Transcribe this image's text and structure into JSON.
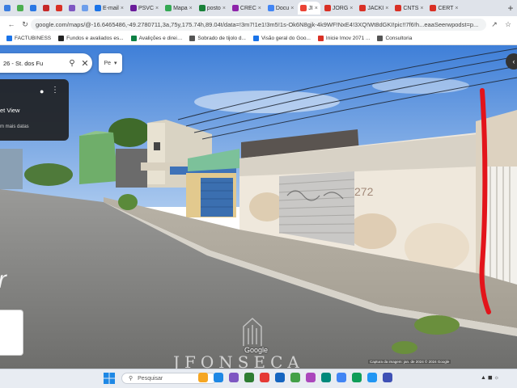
{
  "browser": {
    "tabs": [
      {
        "label": "",
        "color": "#3b7de0"
      },
      {
        "label": "",
        "color": "#4caf50"
      },
      {
        "label": "",
        "color": "#2b78e4"
      },
      {
        "label": "",
        "color": "#c62828"
      },
      {
        "label": "",
        "color": "#d93025"
      },
      {
        "label": "",
        "color": "#7e57c2"
      },
      {
        "label": "",
        "color": "#6d9eeb"
      },
      {
        "label": "E-mail",
        "color": "#1a73e8"
      },
      {
        "label": "PSVC",
        "color": "#6a1b9a"
      },
      {
        "label": "Mapa",
        "color": "#34a853"
      },
      {
        "label": "posto",
        "color": "#188038"
      },
      {
        "label": "CREC",
        "color": "#8e24aa"
      },
      {
        "label": "Docu",
        "color": "#4285f4"
      },
      {
        "label": "JI",
        "color": "#ea4335",
        "active": true
      },
      {
        "label": "JORG",
        "color": "#d93025"
      },
      {
        "label": "JACKI",
        "color": "#d93025"
      },
      {
        "label": "CNTS",
        "color": "#d93025"
      },
      {
        "label": "CERT",
        "color": "#d93025"
      }
    ],
    "url": "google.com/maps/@-16.6465486,-49.2780711,3a,75y,175.74h,89.04t/data=!3m7!1e1!3m5!1s-Ok6N8gjk-4k9WF!NxE4!3XQ!Wt8dGKI!pic!!7f6!h...eaaSeerwpodst=p...",
    "bookmarks": [
      {
        "label": "FACTUBINESS",
        "color": "#1a73e8"
      },
      {
        "label": "Fundos e avaliados es...",
        "color": "#222"
      },
      {
        "label": "Avalições e direi…",
        "color": "#0b8043"
      },
      {
        "label": "Sobrado de tijolo d...",
        "color": "#555"
      },
      {
        "label": "Visão geral do Goo...",
        "color": "#1a73e8"
      },
      {
        "label": "Inicie Imov 2071 ...",
        "color": "#d93025"
      },
      {
        "label": "Consultoria",
        "color": "#555"
      }
    ]
  },
  "maps": {
    "search_text": "26 - St. dos Fu",
    "dropdown_label": "Pe",
    "panel_title": "et View",
    "panel_subtitle": "m mais datas",
    "house_number": "272",
    "street_marking": "17 Rr",
    "google_label": "Google",
    "attribution": "Captura da imagem: jan. de 2024   © 2024 Google"
  },
  "watermark": {
    "text": "JFONSECA"
  },
  "taskbar": {
    "search_placeholder": "Pesquisar",
    "icons": [
      "#f5a623",
      "#1e88e5",
      "#7e57c2",
      "#2e7d32",
      "#e53935",
      "#1565c0",
      "#43a047",
      "#ab47bc",
      "#00897b",
      "#4285f4",
      "#0f9d58",
      "#2196f3",
      "#3f51b5"
    ]
  }
}
